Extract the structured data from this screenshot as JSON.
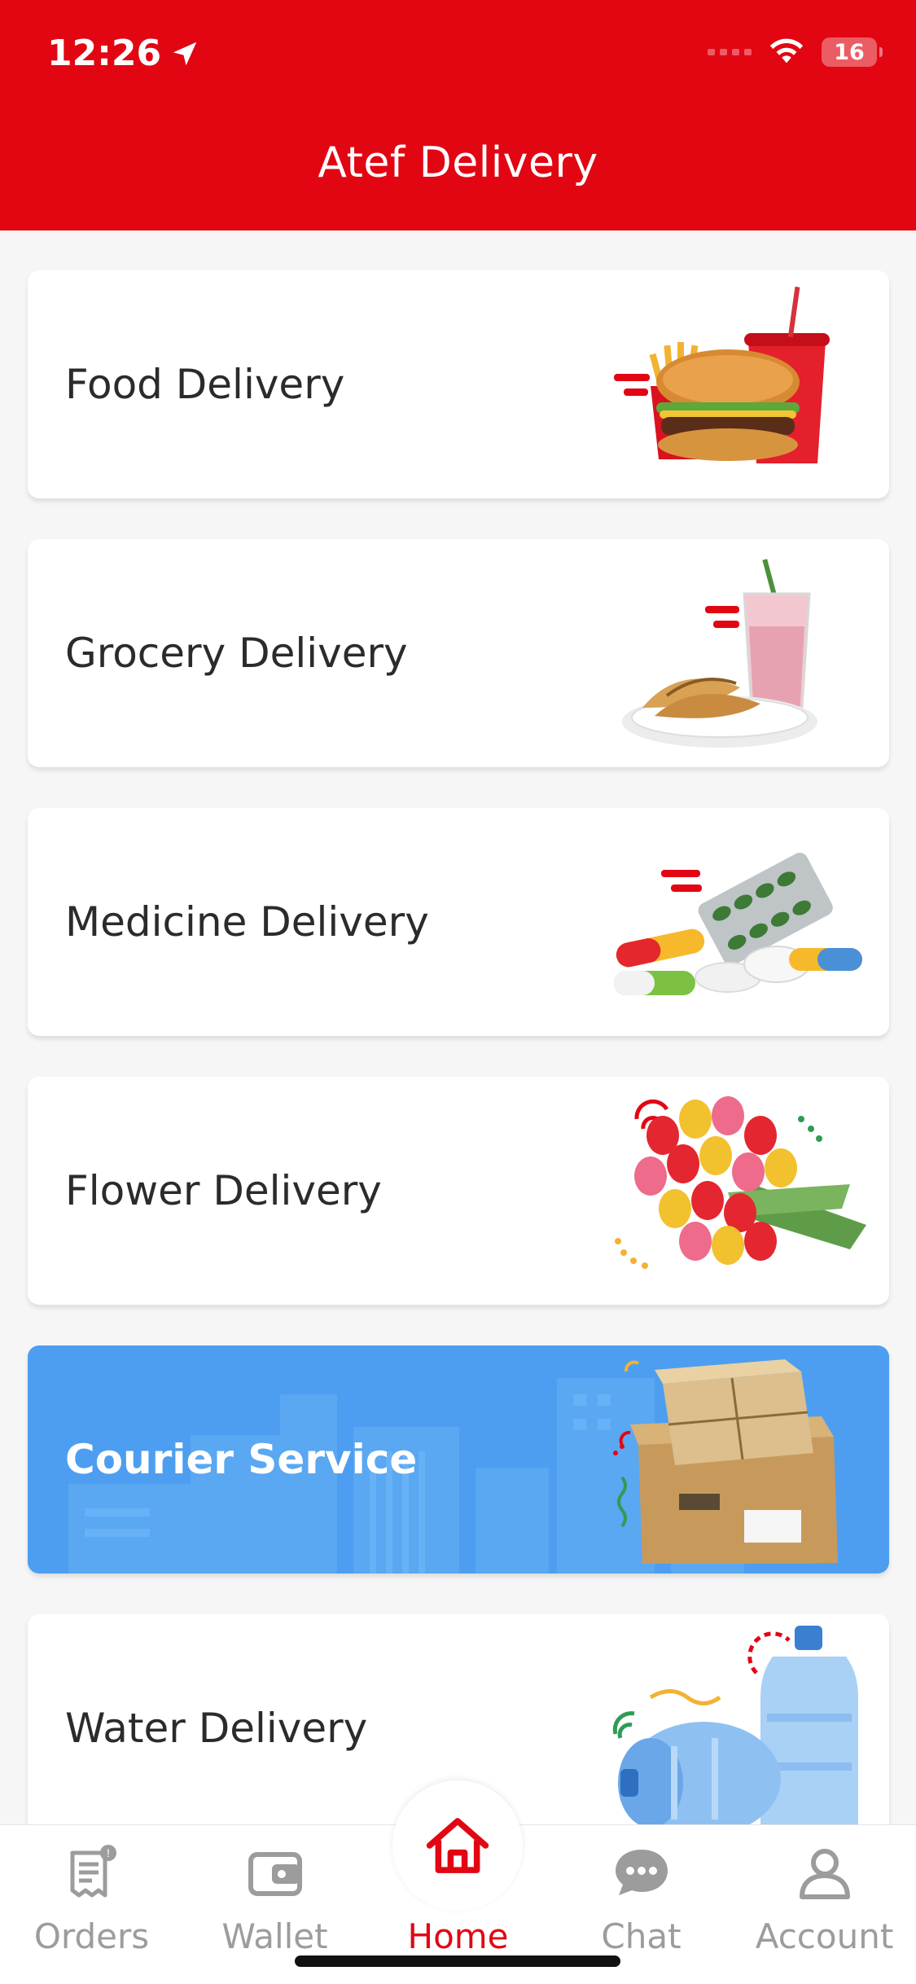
{
  "status_bar": {
    "time": "12:26",
    "battery": "16"
  },
  "header": {
    "title": "Atef Delivery"
  },
  "services": [
    {
      "label": "Food Delivery"
    },
    {
      "label": "Grocery Delivery"
    },
    {
      "label": "Medicine Delivery"
    },
    {
      "label": "Flower Delivery"
    },
    {
      "label": "Courier Service"
    },
    {
      "label": "Water Delivery"
    }
  ],
  "bottom_nav": {
    "items": [
      {
        "label": "Orders",
        "icon": "orders-receipt-icon"
      },
      {
        "label": "Wallet",
        "icon": "wallet-icon"
      },
      {
        "label": "Home",
        "icon": "home-icon"
      },
      {
        "label": "Chat",
        "icon": "chat-bubble-icon"
      },
      {
        "label": "Account",
        "icon": "account-user-icon"
      }
    ],
    "active": "Home"
  },
  "colors": {
    "brand_red": "#e20613",
    "courier_blue": "#4d9ef0",
    "inactive_gray": "#9c9c9c",
    "background": "#f6f6f6"
  }
}
